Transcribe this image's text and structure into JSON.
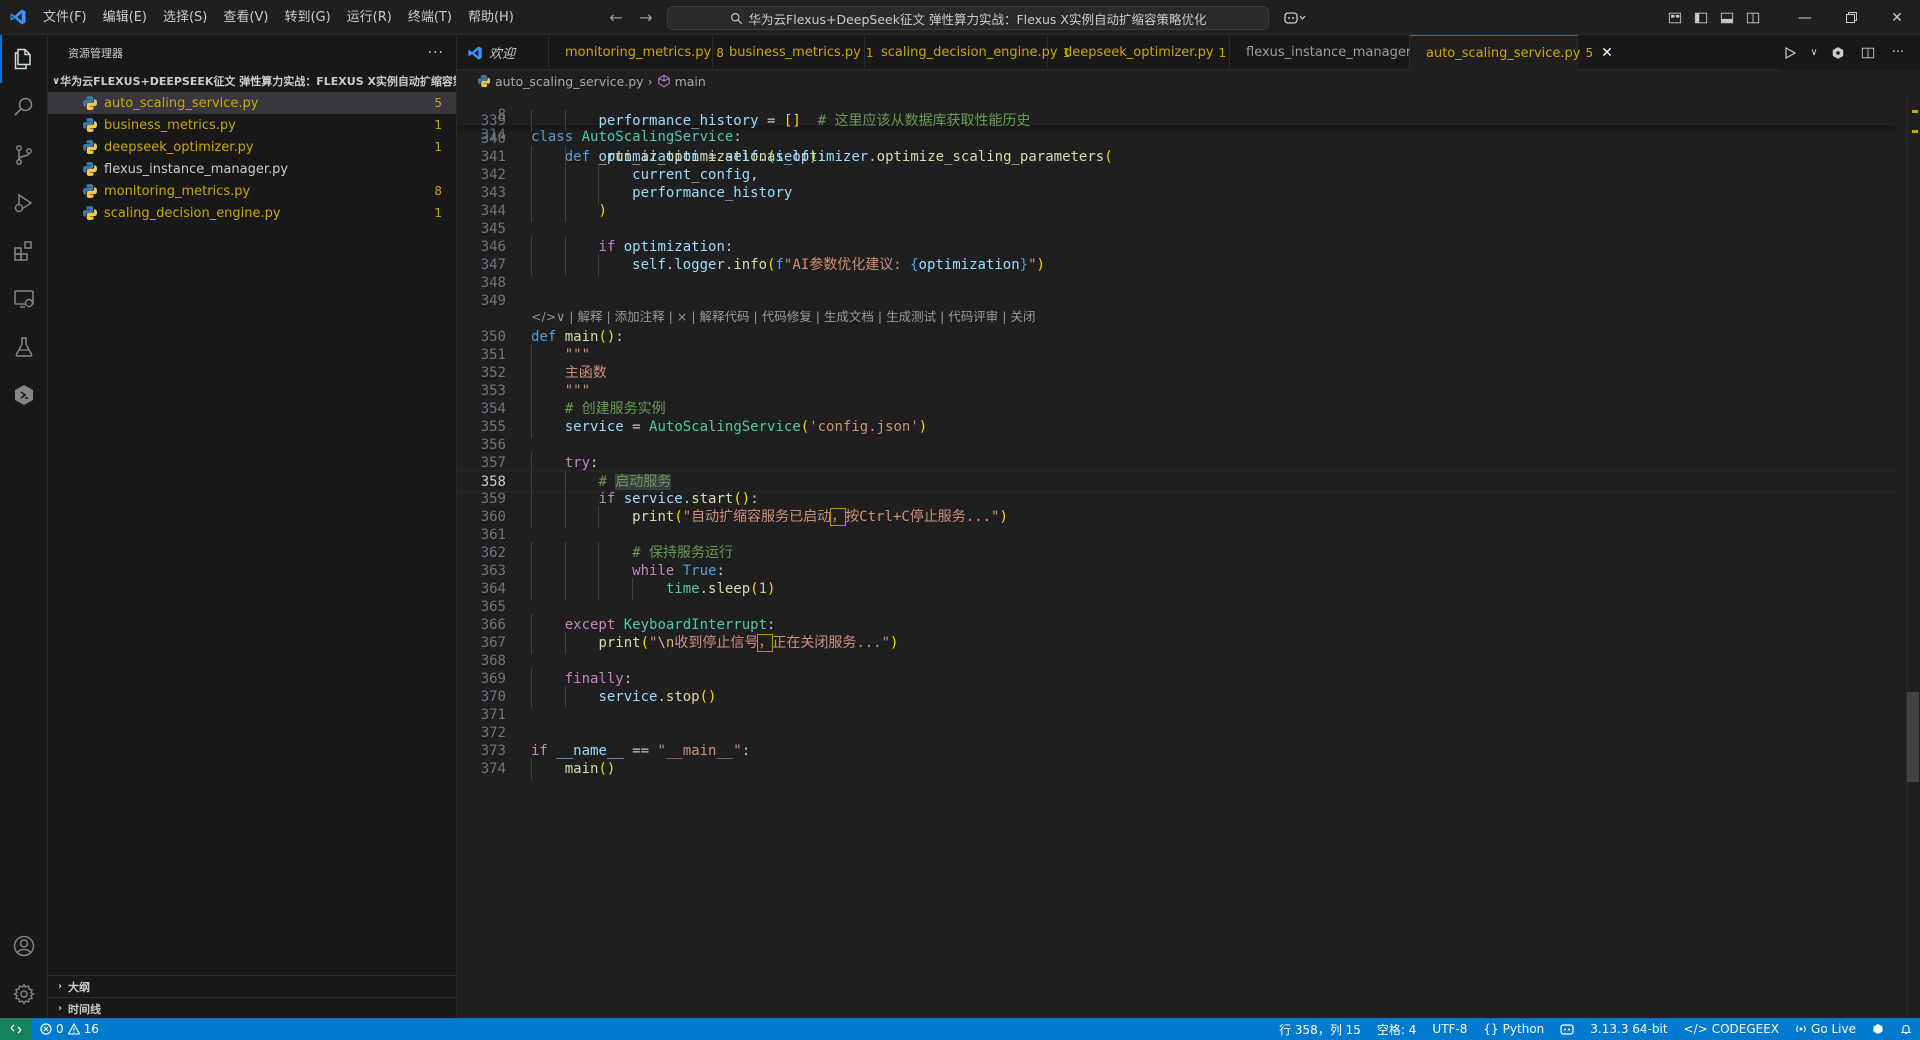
{
  "menu": [
    "文件(F)",
    "编辑(E)",
    "选择(S)",
    "查看(V)",
    "转到(G)",
    "运行(R)",
    "终端(T)",
    "帮助(H)"
  ],
  "command_center": "华为云Flexus+DeepSeek征文 弹性算力实战：Flexus X实例自动扩缩容策略优化",
  "sidebar": {
    "title": "资源管理器",
    "folder": "华为云FLEXUS+DEEPSEEK征文 弹性算力实战：FLEXUS X实例自动扩缩容策...",
    "files": [
      {
        "name": "auto_scaling_service.py",
        "badge": "5"
      },
      {
        "name": "business_metrics.py",
        "badge": "1"
      },
      {
        "name": "deepseek_optimizer.py",
        "badge": "1"
      },
      {
        "name": "flexus_instance_manager.py",
        "badge": ""
      },
      {
        "name": "monitoring_metrics.py",
        "badge": "8"
      },
      {
        "name": "scaling_decision_engine.py",
        "badge": "1"
      }
    ],
    "outline_label": "大纲",
    "timeline_label": "时间线"
  },
  "tabs": [
    {
      "label": "欢迎",
      "badge": ""
    },
    {
      "label": "monitoring_metrics.py",
      "badge": "8"
    },
    {
      "label": "business_metrics.py",
      "badge": "1"
    },
    {
      "label": "scaling_decision_engine.py",
      "badge": "1"
    },
    {
      "label": "deepseek_optimizer.py",
      "badge": "1"
    },
    {
      "label": "flexus_instance_manager.py",
      "badge": ""
    },
    {
      "label": "auto_scaling_service.py",
      "badge": "5"
    }
  ],
  "breadcrumb": {
    "file": "auto_scaling_service.py",
    "symbol": "main"
  },
  "codelens": {
    "items": [
      "解释",
      "添加注释",
      "×",
      "解释代码",
      "代码修复",
      "生成文档",
      "生成测试",
      "代码评审",
      "关闭"
    ]
  },
  "editor": {
    "sticky": [
      {
        "n": "8",
        "text": "class AutoScalingService:"
      },
      {
        "n": "314",
        "text": "    def _run_ai_optimization(self):"
      }
    ],
    "lines": [
      {
        "n": "339",
        "text": "        performance_history = []  # 这里应该从数据库获取性能历史"
      },
      {
        "n": "340",
        "text": ""
      },
      {
        "n": "341",
        "text": "        optimization = self.ai_optimizer.optimize_scaling_parameters("
      },
      {
        "n": "342",
        "text": "            current_config,"
      },
      {
        "n": "343",
        "text": "            performance_history"
      },
      {
        "n": "344",
        "text": "        )"
      },
      {
        "n": "345",
        "text": ""
      },
      {
        "n": "346",
        "text": "        if optimization:"
      },
      {
        "n": "347",
        "text": "            self.logger.info(f\"AI参数优化建议: {optimization}\")"
      },
      {
        "n": "348",
        "text": ""
      },
      {
        "n": "349",
        "text": ""
      },
      {
        "n": "350",
        "text": "def main():"
      },
      {
        "n": "351",
        "text": "    \"\"\""
      },
      {
        "n": "352",
        "text": "    主函数"
      },
      {
        "n": "353",
        "text": "    \"\"\""
      },
      {
        "n": "354",
        "text": "    # 创建服务实例"
      },
      {
        "n": "355",
        "text": "    service = AutoScalingService('config.json')"
      },
      {
        "n": "356",
        "text": ""
      },
      {
        "n": "357",
        "text": "    try:"
      },
      {
        "n": "358",
        "text": "        # 启动服务"
      },
      {
        "n": "359",
        "text": "        if service.start():"
      },
      {
        "n": "360",
        "text": "            print(\"自动扩缩容服务已启动，按Ctrl+C停止服务...\")"
      },
      {
        "n": "361",
        "text": ""
      },
      {
        "n": "362",
        "text": "            # 保持服务运行"
      },
      {
        "n": "363",
        "text": "            while True:"
      },
      {
        "n": "364",
        "text": "                time.sleep(1)"
      },
      {
        "n": "365",
        "text": ""
      },
      {
        "n": "366",
        "text": "    except KeyboardInterrupt:"
      },
      {
        "n": "367",
        "text": "        print(\"\\n收到停止信号，正在关闭服务...\")"
      },
      {
        "n": "368",
        "text": ""
      },
      {
        "n": "369",
        "text": "    finally:"
      },
      {
        "n": "370",
        "text": "        service.stop()"
      },
      {
        "n": "371",
        "text": ""
      },
      {
        "n": "372",
        "text": ""
      },
      {
        "n": "373",
        "text": "if __name__ == \"__main__\":"
      },
      {
        "n": "374",
        "text": "    main()"
      }
    ],
    "current_line": "358"
  },
  "statusbar": {
    "errors": "0",
    "warnings": "16",
    "position": "行 358，列 15",
    "spaces": "空格: 4",
    "encoding": "UTF-8",
    "language": "Python",
    "python_version": "3.13.3 64-bit",
    "codegeex": "CODEGEEX",
    "golive": "Go Live"
  },
  "colors": {
    "accent": "#0078d4",
    "statusbar": "#007acc",
    "warning": "#cca700",
    "remote": "#16825d"
  },
  "icons": {
    "activity": [
      "explorer-icon",
      "search-icon",
      "source-control-icon",
      "run-debug-icon",
      "extensions-icon",
      "remote-explorer-icon",
      "testing-icon",
      "codegeex-icon"
    ],
    "activity_bottom": [
      "account-icon",
      "settings-icon"
    ]
  }
}
